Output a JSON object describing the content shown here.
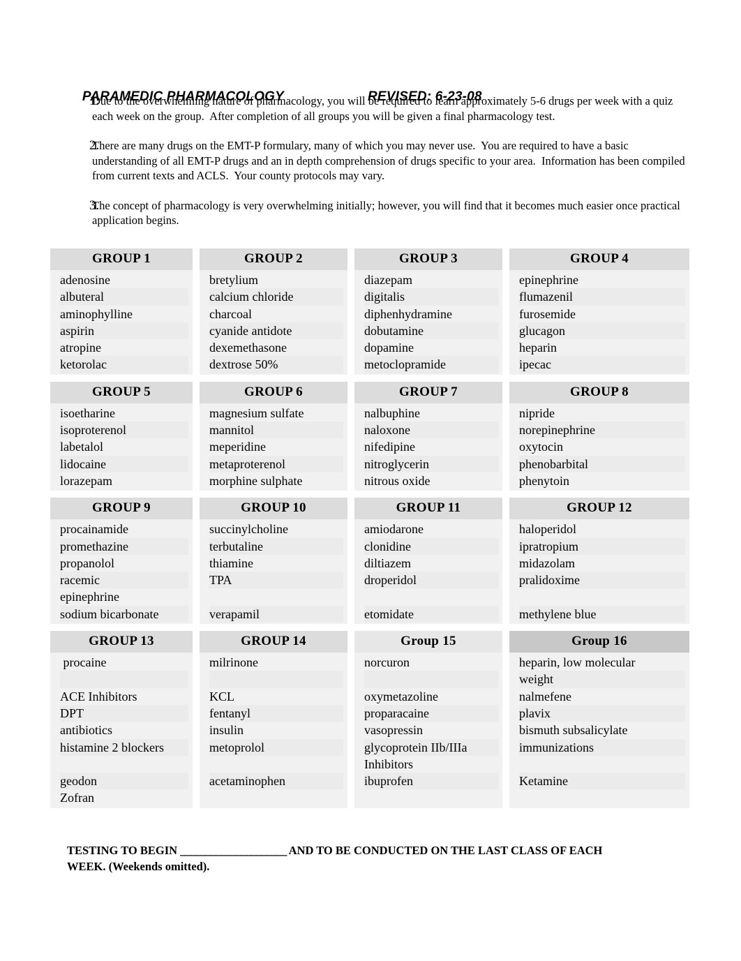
{
  "header": {
    "title": "PARAMEDIC PHARMACOLOGY",
    "revised": "REVISED: 6-23-08"
  },
  "intro": [
    {
      "number": "1.",
      "text": "Due to the overwhelming nature of pharmacology, you will be required to learn approximately 5-6 drugs per week with a quiz each week on the group.  After completion of all groups you will be given a final pharmacology test."
    },
    {
      "number": "2.",
      "text": "There are many drugs on the EMT-P formulary, many of which you may never use.  You are required to have a basic understanding of all EMT-P drugs and an in depth comprehension of drugs specific to your area.  Information has been compiled from current texts and ACLS.  Your county protocols may vary."
    },
    {
      "number": "3.",
      "text": "The concept of pharmacology is very overwhelming initially; however, you will find that it becomes much easier once practical application begins."
    }
  ],
  "blocks": [
    {
      "headers": [
        "GROUP 1",
        "GROUP 2",
        "GROUP 3",
        "GROUP 4"
      ],
      "columns": [
        [
          "adenosine",
          "albuteral",
          "aminophylline",
          "aspirin",
          "atropine",
          "ketorolac"
        ],
        [
          "bretylium",
          "calcium chloride",
          "charcoal",
          "cyanide antidote",
          "dexemethasone",
          "dextrose 50%"
        ],
        [
          "diazepam",
          "digitalis",
          "diphenhydramine",
          "dobutamine",
          "dopamine",
          "metoclopramide"
        ],
        [
          "epinephrine",
          "flumazenil",
          "furosemide",
          "glucagon",
          "heparin",
          "ipecac"
        ]
      ]
    },
    {
      "headers": [
        "GROUP 5",
        "GROUP 6",
        "GROUP 7",
        "GROUP 8"
      ],
      "columns": [
        [
          "isoetharine",
          "isoproterenol",
          "labetalol",
          "lidocaine",
          "lorazepam"
        ],
        [
          "magnesium sulfate",
          "mannitol",
          "meperidine",
          "metaproterenol",
          "morphine sulphate"
        ],
        [
          "nalbuphine",
          "naloxone",
          "nifedipine",
          "nitroglycerin",
          "nitrous oxide"
        ],
        [
          "nipride",
          "norepinephrine",
          "oxytocin",
          "phenobarbital",
          "phenytoin"
        ]
      ]
    },
    {
      "headers": [
        "GROUP 9",
        "GROUP 10",
        "GROUP 11",
        "GROUP 12"
      ],
      "columns": [
        [
          "procainamide",
          "promethazine",
          "propanolol",
          "racemic",
          "epinephrine",
          "sodium bicarbonate"
        ],
        [
          "succinylcholine",
          "terbutaline",
          "thiamine",
          "TPA",
          "",
          "verapamil"
        ],
        [
          "amiodarone",
          "clonidine",
          "diltiazem",
          "droperidol",
          "",
          "etomidate"
        ],
        [
          "haloperidol",
          "ipratropium",
          "midazolam",
          "pralidoxime",
          "",
          "methylene blue"
        ]
      ]
    },
    {
      "headers": [
        "GROUP 13",
        "GROUP 14",
        "Group 15",
        "Group 16"
      ],
      "header_shades": [
        "normal",
        "normal",
        "light",
        "dark"
      ],
      "columns": [
        [
          " procaine",
          "",
          "ACE Inhibitors",
          "DPT",
          "antibiotics",
          "histamine 2 blockers",
          "",
          "geodon",
          "Zofran"
        ],
        [
          "milrinone",
          "",
          "KCL",
          "fentanyl",
          "insulin",
          "metoprolol",
          "",
          "acetaminophen",
          ""
        ],
        [
          "norcuron",
          "",
          "oxymetazoline",
          "proparacaine",
          "vasopressin",
          "glycoprotein IIb/IIIa",
          "Inhibitors",
          "ibuprofen",
          ""
        ],
        [
          "heparin, low molecular",
          "weight",
          "nalmefene",
          "plavix",
          "bismuth subsalicylate",
          "immunizations",
          "",
          "Ketamine",
          ""
        ]
      ]
    }
  ],
  "footer": {
    "line1_before": "TESTING TO BEGIN ",
    "line1_blank": "_____________________",
    "line1_after": " AND TO BE CONDUCTED ON THE LAST CLASS OF EACH",
    "line2": "WEEK.  (Weekends omitted)."
  }
}
